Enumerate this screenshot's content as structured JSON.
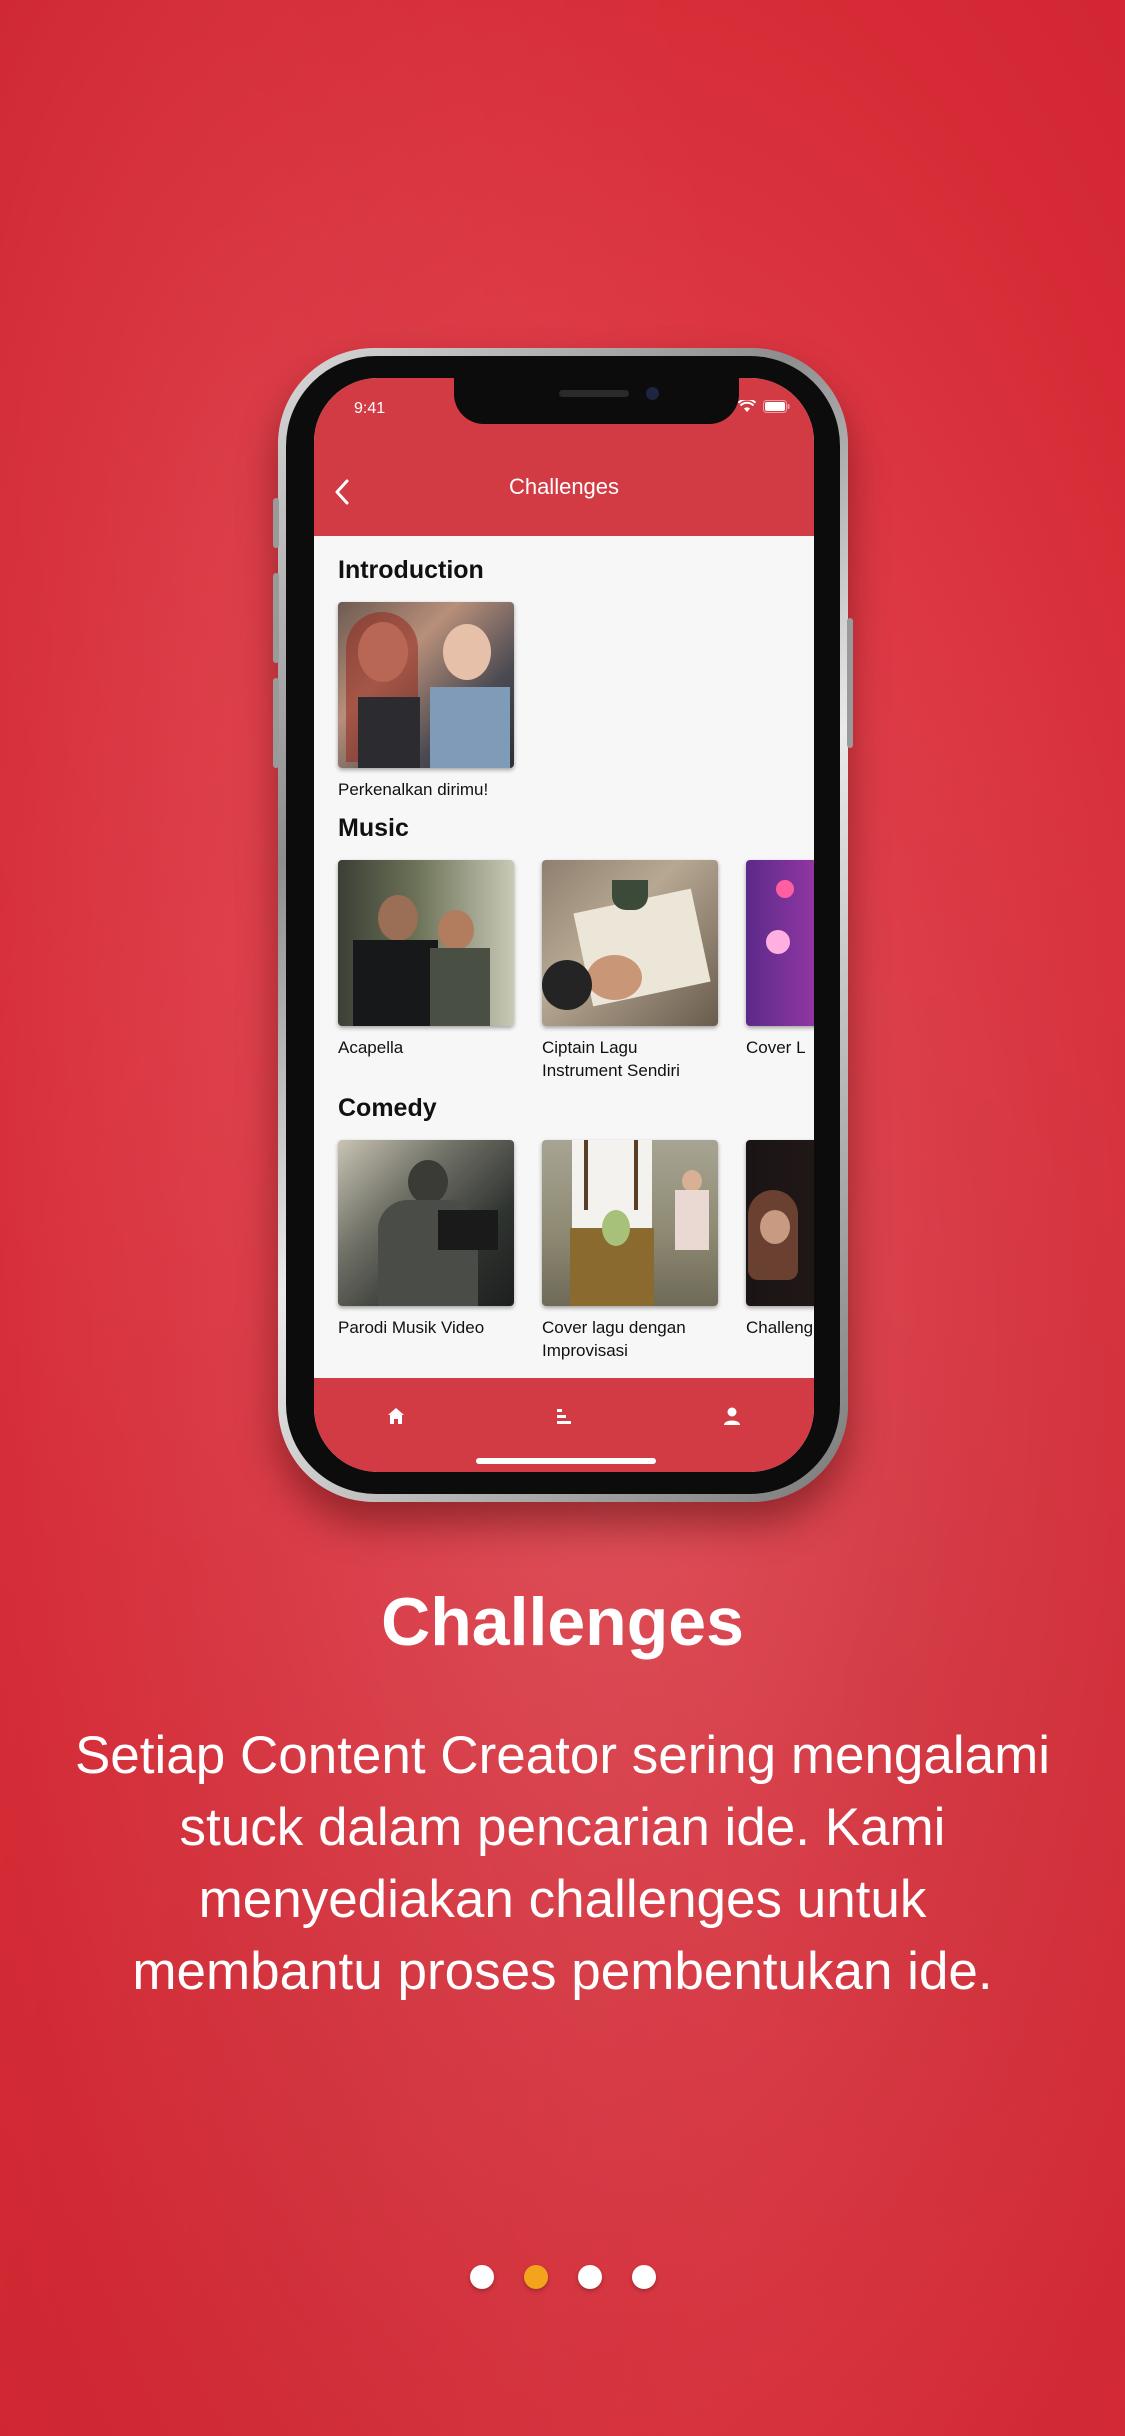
{
  "status_bar": {
    "time": "9:41"
  },
  "app_bar": {
    "title": "Challenges"
  },
  "sections": [
    {
      "title": "Introduction",
      "items": [
        {
          "label": "Perkenalkan dirimu!"
        }
      ]
    },
    {
      "title": "Music",
      "items": [
        {
          "label": "Acapella"
        },
        {
          "label": "Ciptain Lagu Instrument Sendiri"
        },
        {
          "label": "Cover L"
        }
      ]
    },
    {
      "title": "Comedy",
      "items": [
        {
          "label": "Parodi Musik Video"
        },
        {
          "label": "Cover lagu dengan Improvisasi"
        },
        {
          "label": "Challeng"
        }
      ]
    }
  ],
  "tab_bar": {
    "tabs": [
      "home-icon",
      "ranking-icon",
      "profile-icon"
    ]
  },
  "onboarding": {
    "headline": "Challenges",
    "body": "Setiap Content Creator sering mengalami stuck dalam pencarian ide. Kami menyediakan challenges untuk membantu proses pembentukan ide.",
    "page_index": 1,
    "page_count": 4
  },
  "colors": {
    "brand_red": "#d23a44",
    "active_dot": "#f2a51c"
  }
}
